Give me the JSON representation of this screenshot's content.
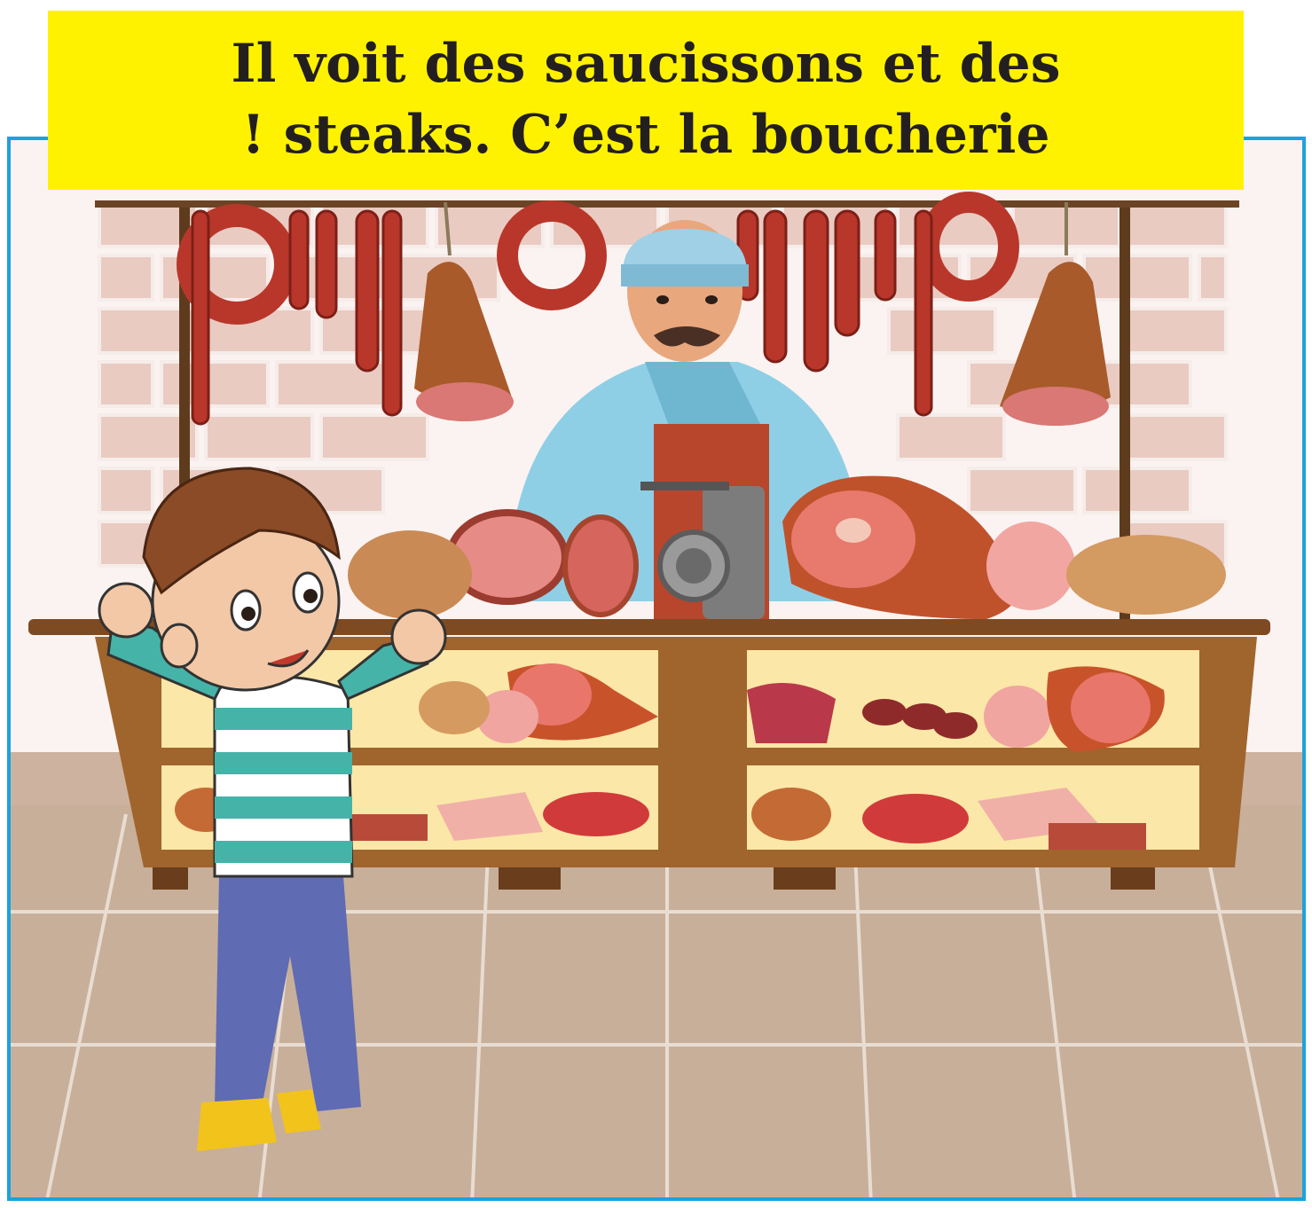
{
  "caption": {
    "line1": "Il voit des saucissons et des",
    "line2": "! steaks. C’est la boucherie"
  },
  "colors": {
    "frame": "#1aa3dd",
    "caption_bg": "#fff200",
    "caption_text": "#231f20",
    "wall": "#f6ece9",
    "brick": "#e6c6bd",
    "floor": "#c6ad98",
    "counter": "#a0642d",
    "butcher_shirt": "#8fcfe6",
    "apron": "#b8462c",
    "boy_stripe": "#46b3a8",
    "boy_pants": "#5f6bb3"
  },
  "scene": {
    "figures": [
      "boy",
      "butcher"
    ],
    "items": [
      "sausages",
      "hams",
      "salami",
      "steaks",
      "minced-meat",
      "bacon",
      "meat-grinder"
    ]
  }
}
